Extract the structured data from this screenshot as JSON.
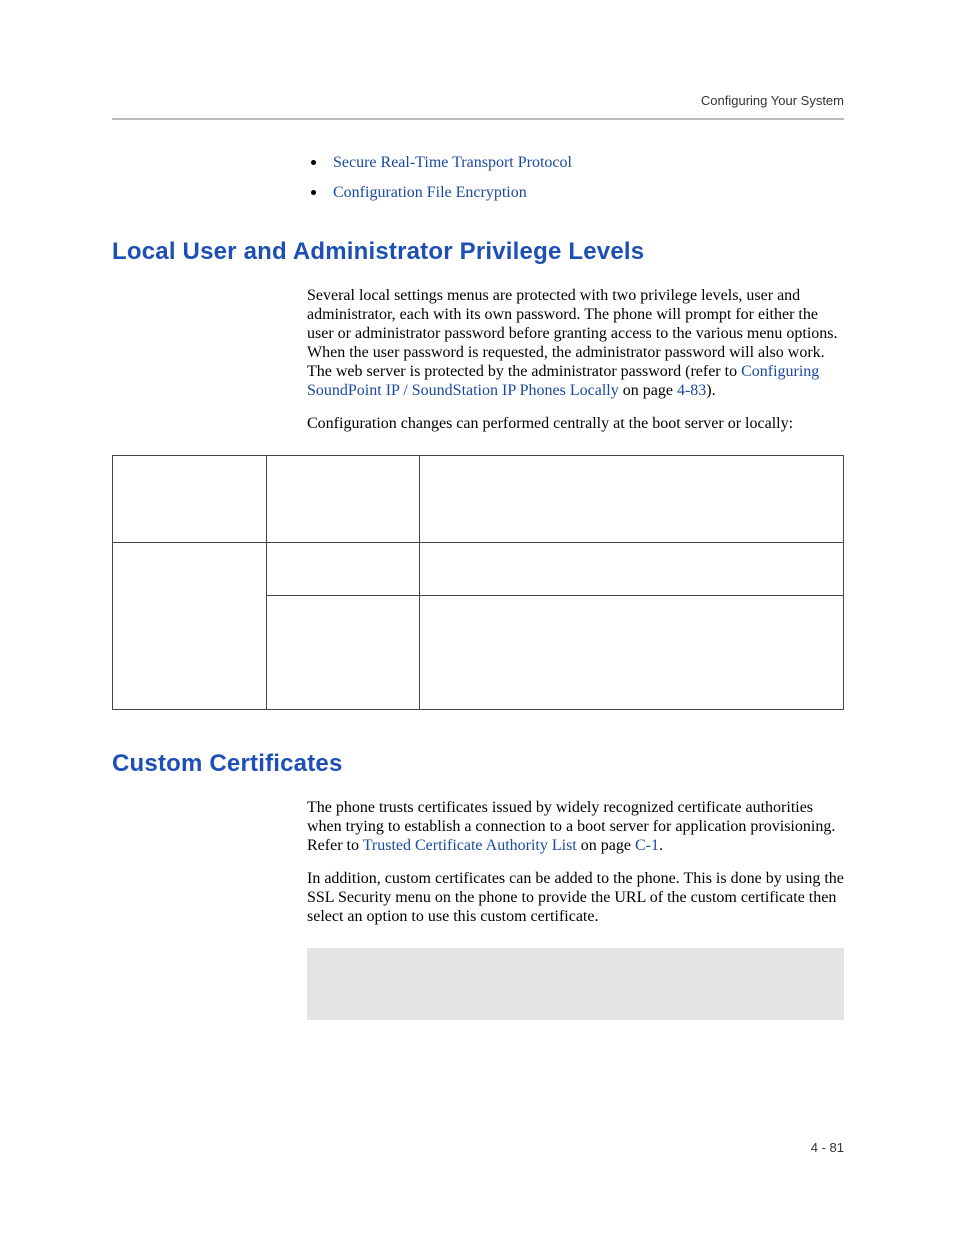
{
  "header": {
    "running_head": "Configuring Your System",
    "page_number": "4 - 81"
  },
  "intro_bullets": [
    "Secure Real-Time Transport Protocol",
    "Configuration File Encryption"
  ],
  "sections": {
    "privilege": {
      "title": "Local User and Administrator Privilege Levels",
      "para1_pre": "Several local settings menus are protected with two privilege levels, user and administrator, each with its own password. The phone will prompt for either the user or administrator password before granting access to the various menu options. When the user password is requested, the administrator password will also work. The web server is protected by the administrator password (refer to ",
      "para1_link": "Configuring SoundPoint IP / SoundStation IP Phones Locally",
      "para1_mid": " on page ",
      "para1_page": "4-83",
      "para1_post": ").",
      "para2": "Configuration changes can performed centrally at the boot server or locally:"
    },
    "certificates": {
      "title": "Custom Certificates",
      "para1_pre": "The phone trusts certificates issued by widely recognized certificate authorities when trying to establish a connection to a boot server for application provisioning. Refer to ",
      "para1_link": "Trusted Certificate Authority List",
      "para1_mid": " on page ",
      "para1_page": "C-1",
      "para1_post": ".",
      "para2": "In addition, custom certificates can be added to the phone. This is done by using the SSL Security menu on the phone to provide the URL of the custom certificate then select an option to use this custom certificate."
    }
  }
}
